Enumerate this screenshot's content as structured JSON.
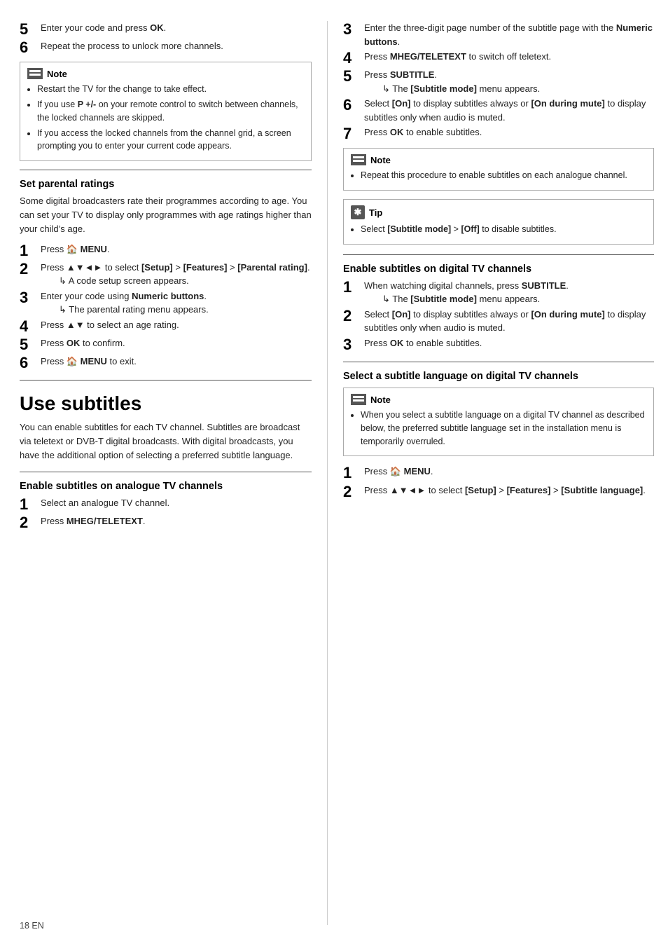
{
  "page_footer": "18    EN",
  "left_col": {
    "steps_top": [
      {
        "num": "5",
        "text": "Enter your code and press <b>OK</b>.",
        "size": "large"
      },
      {
        "num": "6",
        "text": "Repeat the process to unlock more channels.",
        "size": "large"
      }
    ],
    "note1": {
      "label": "Note",
      "items": [
        "Restart the TV for the change to take effect.",
        "If you use <b>P +/-</b> on your remote control to switch between channels, the locked channels are skipped.",
        "If you access the locked channels from the channel grid, a screen prompting you to enter your current code appears."
      ]
    },
    "set_parental": {
      "title": "Set parental ratings",
      "body": "Some digital broadcasters rate their programmes according to age. You can set your TV to display only programmes with age ratings higher than your child’s age.",
      "steps": [
        {
          "num": "1",
          "text": "Press 🏠 <b>MENU</b>."
        },
        {
          "num": "2",
          "text": "Press ▲▼◄► to select <b>[Setup]</b> > <b>[Features]</b> > <b>[Parental rating]</b>.",
          "sub": "→ A code setup screen appears."
        },
        {
          "num": "3",
          "text": "Enter your code using <b>Numeric buttons</b>.",
          "sub": "→ The parental rating menu appears."
        },
        {
          "num": "4",
          "text": "Press ▲▼ to select an age rating."
        },
        {
          "num": "5",
          "text": "Press <b>OK</b> to confirm."
        },
        {
          "num": "6",
          "text": "Press 🏠 <b>MENU</b> to exit."
        }
      ]
    },
    "use_subtitles": {
      "title": "Use subtitles",
      "body": "You can enable subtitles for each TV channel. Subtitles are broadcast via teletext or DVB-T digital broadcasts. With digital broadcasts, you have the additional option of selecting a preferred subtitle language."
    },
    "enable_analogue": {
      "title": "Enable subtitles on analogue TV channels",
      "steps": [
        {
          "num": "1",
          "text": "Select an analogue TV channel."
        },
        {
          "num": "2",
          "text": "Press <b>MHEG/TELETEXT</b>."
        }
      ]
    }
  },
  "right_col": {
    "steps_top": [
      {
        "num": "3",
        "text": "Enter the three-digit page number of the subtitle page with the <b>Numeric buttons</b>."
      },
      {
        "num": "4",
        "text": "Press <b>MHEG/TELETEXT</b> to switch off teletext."
      },
      {
        "num": "5",
        "text": "Press <b>SUBTITLE</b>.",
        "sub": "→ The [Subtitle mode] menu appears."
      },
      {
        "num": "6",
        "text": "Select <b>[On]</b> to display subtitles always or <b>[On during mute]</b> to display subtitles only when audio is muted."
      },
      {
        "num": "7",
        "text": "Press <b>OK</b> to enable subtitles."
      }
    ],
    "note2": {
      "label": "Note",
      "items": [
        "Repeat this procedure to enable subtitles on each analogue channel."
      ]
    },
    "tip1": {
      "label": "Tip",
      "items": [
        "Select <b>[Subtitle mode]</b> > <b>[Off]</b> to disable subtitles."
      ]
    },
    "enable_digital": {
      "title": "Enable subtitles on digital TV channels",
      "steps": [
        {
          "num": "1",
          "text": "When watching digital channels, press <b>SUBTITLE</b>.",
          "sub": "→ The [Subtitle mode] menu appears."
        },
        {
          "num": "2",
          "text": "Select <b>[On]</b> to display subtitles always or <b>[On during mute]</b> to display subtitles only when audio is muted."
        },
        {
          "num": "3",
          "text": "Press <b>OK</b> to enable subtitles."
        }
      ]
    },
    "select_lang": {
      "title": "Select a subtitle language on digital TV channels",
      "note": {
        "label": "Note",
        "items": [
          "When you select a subtitle language on a digital TV channel as described below, the preferred subtitle language set in the installation menu is temporarily overruled."
        ]
      },
      "steps": [
        {
          "num": "1",
          "text": "Press 🏠 <b>MENU</b>."
        },
        {
          "num": "2",
          "text": "Press ▲▼◄► to select <b>[Setup]</b> > <b>[Features]</b> > <b>[Subtitle language]</b>."
        }
      ]
    }
  }
}
